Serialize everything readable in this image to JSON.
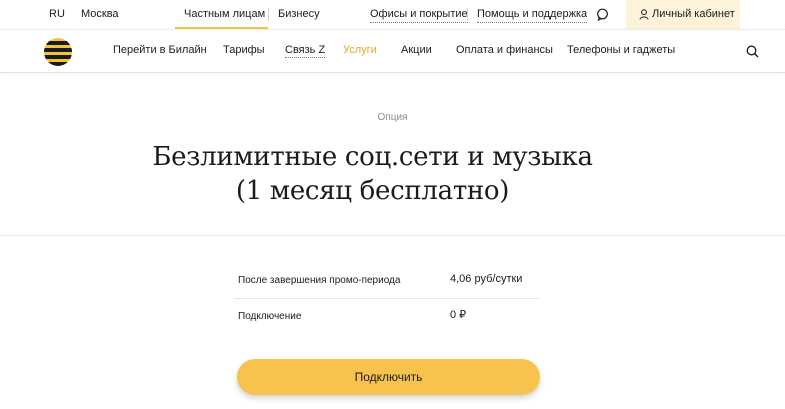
{
  "topbar": {
    "language": "RU",
    "city": "Москва",
    "segments": [
      "Частным лицам",
      "Бизнесу"
    ],
    "links": [
      "Офисы и покрытие",
      "Помощь и поддержка"
    ],
    "account_label": "Личный кабинет"
  },
  "nav": {
    "items": [
      "Перейти в Билайн",
      "Тарифы",
      "Связь Z",
      "Услуги",
      "Акции",
      "Оплата и финансы",
      "Телефоны и гаджеты"
    ],
    "active_item": "Услуги"
  },
  "hero": {
    "eyebrow": "Опция",
    "title_line1": "Безлимитные соц.сети и музыка",
    "title_line2": "(1 месяц бесплатно)"
  },
  "pricing": {
    "rows": [
      {
        "label": "После завершения промо-периода",
        "value": "4,06 руб/сутки"
      },
      {
        "label": "Подключение",
        "value": "0 ₽"
      }
    ]
  },
  "cta": {
    "label": "Подключить"
  },
  "colors": {
    "brand_yellow": "#f6c33b",
    "button_yellow": "#f8c24e",
    "active_orange": "#e8a32e",
    "dark": "#191c1f"
  }
}
